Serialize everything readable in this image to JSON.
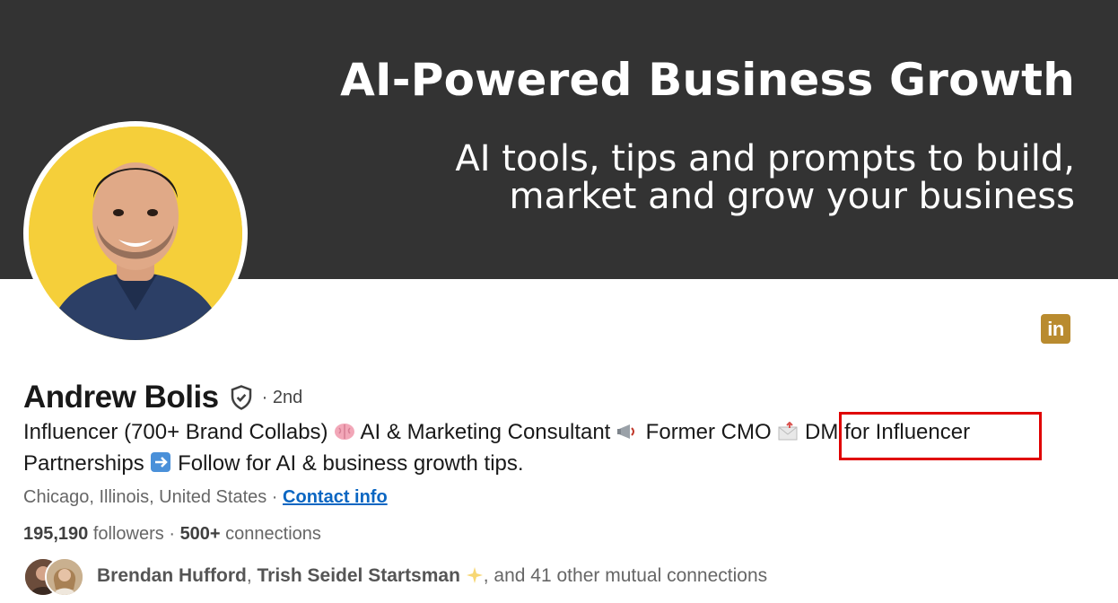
{
  "banner": {
    "title": "AI-Powered Business Growth",
    "subtitle_line1": "AI tools, tips and prompts to build,",
    "subtitle_line2": "market and grow your business"
  },
  "profile": {
    "name": "Andrew Bolis",
    "degree": "· 2nd",
    "headline_parts": {
      "p1": "Influencer (700+ Brand Collabs) ",
      "p2": " AI & Marketing Consultant ",
      "p3": " Former CMO ",
      "p4": " DM for Influencer",
      "p5": "Partnerships ",
      "p6": " Follow for AI & business growth tips."
    },
    "location": "Chicago, Illinois, United States · ",
    "contact_info_label": "Contact info",
    "followers_count": "195,190",
    "followers_label": " followers",
    "connections_sep": "  · ",
    "connections_count": "500+",
    "connections_label": " connections"
  },
  "mutuals": {
    "name1": "Brendan Hufford",
    "sep": ", ",
    "name2": "Trish Seidel Startsman",
    "rest": ", and 41 other mutual connections"
  },
  "icons": {
    "linkedin": "linkedin-icon",
    "verified": "verified-shield-icon",
    "brain": "brain-emoji",
    "megaphone": "megaphone-emoji",
    "envelope": "envelope-emoji",
    "arrow": "right-arrow-emoji",
    "sparkles": "sparkles-emoji"
  },
  "colors": {
    "banner_bg": "#333333",
    "link": "#0a66c2",
    "highlight_box": "#e00000",
    "linkedin_badge": "#b98b2f",
    "avatar_bg": "#f5cf3a"
  }
}
